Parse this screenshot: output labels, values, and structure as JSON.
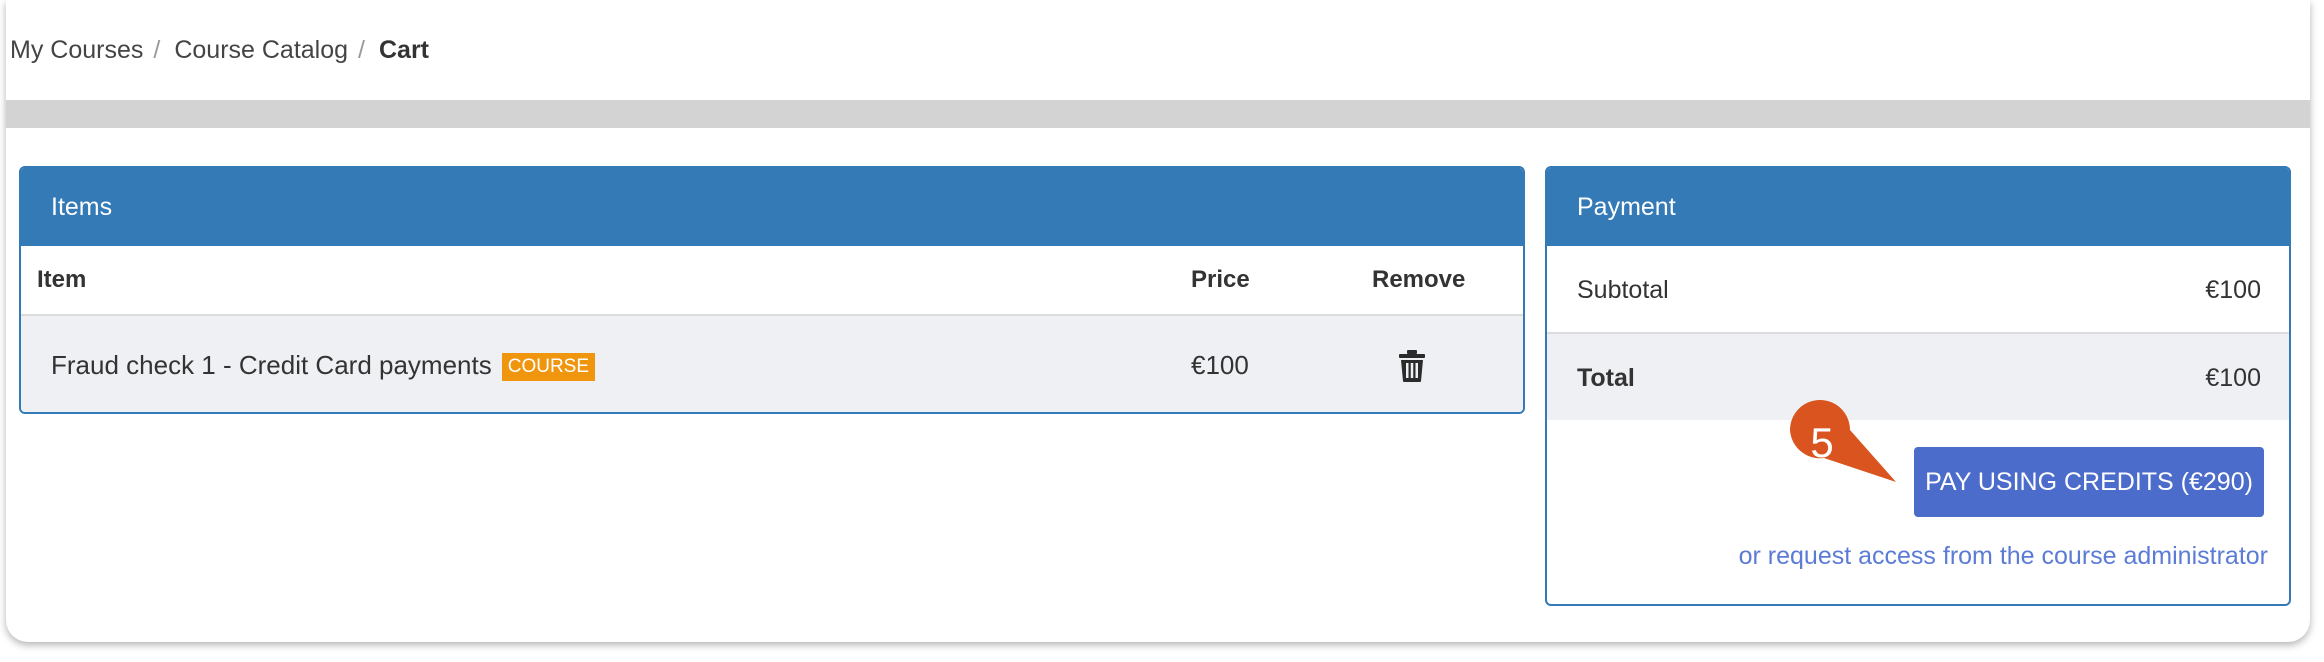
{
  "breadcrumb": {
    "items": [
      "My Courses",
      "Course Catalog"
    ],
    "separator": "/",
    "current": "Cart"
  },
  "items_panel": {
    "title": "Items",
    "columns": {
      "item": "Item",
      "price": "Price",
      "remove": "Remove"
    },
    "rows": [
      {
        "name": "Fraud check 1 - Credit Card payments",
        "badge": "COURSE",
        "price": "€100",
        "remove_icon": "trash-icon"
      }
    ]
  },
  "payment_panel": {
    "title": "Payment",
    "subtotal_label": "Subtotal",
    "subtotal_value": "€100",
    "total_label": "Total",
    "total_value": "€100",
    "pay_button": "PAY USING CREDITS (€290)",
    "request_link": "or request access from the course administrator"
  },
  "callout": {
    "number": "5",
    "color": "#d9541e"
  },
  "colors": {
    "panel_blue": "#337ab7",
    "button_blue": "#4c6ccc",
    "badge_orange": "#f0960e",
    "link_blue": "#5b7bd6",
    "row_grey": "#eef0f3"
  }
}
